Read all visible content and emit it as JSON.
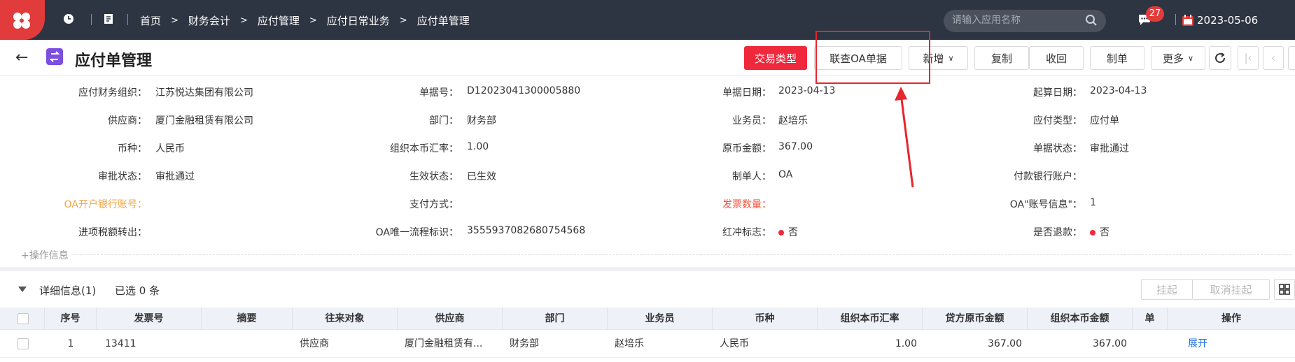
{
  "topbar": {
    "breadcrumbs": [
      "首页",
      "财务会计",
      "应付管理",
      "应付日常业务",
      "应付单管理"
    ],
    "search_placeholder": "请输入应用名称",
    "message_count": "27",
    "date": "2023-05-06"
  },
  "header": {
    "title": "应付单管理",
    "buttons": {
      "trade_type": "交易类型",
      "oa_query": "联查OA单据",
      "add": "新增",
      "copy": "复制",
      "recall": "收回",
      "make": "制单",
      "more": "更多"
    }
  },
  "form": {
    "org_label": "应付财务组织：",
    "org_value": "江苏悦达集团有限公司",
    "billno_label": "单据号：",
    "billno_value": "D12023041300005880",
    "billdate_label": "单据日期：",
    "billdate_value": "2023-04-13",
    "startdate_label": "起算日期：",
    "startdate_value": "2023-04-13",
    "supplier_label": "供应商：",
    "supplier_value": "厦门金融租赁有限公司",
    "dept_label": "部门：",
    "dept_value": "财务部",
    "salesman_label": "业务员：",
    "salesman_value": "赵培乐",
    "paytype_label": "应付类型：",
    "paytype_value": "应付单",
    "currency_label": "币种：",
    "currency_value": "人民币",
    "rate_label": "组织本币汇率：",
    "rate_value": "1.00",
    "amount_label": "原币金额：",
    "amount_value": "367.00",
    "billstatus_label": "单据状态：",
    "billstatus_value": "审批通过",
    "approve_label": "审批状态：",
    "approve_value": "审批通过",
    "effect_label": "生效状态：",
    "effect_value": "已生效",
    "maker_label": "制单人：",
    "maker_value": "OA",
    "bankacct_label": "付款银行账户：",
    "bankacct_value": "",
    "oabank_label": "OA开户银行账号：",
    "oabank_value": "",
    "paymethod_label": "支付方式：",
    "paymethod_value": "",
    "invoicecount_label": "发票数量：",
    "invoicecount_value": "",
    "oaacctinfo_label": "OA\"账号信息\"：",
    "oaacctinfo_value": "1",
    "taxtransfer_label": "进项税额转出：",
    "taxtransfer_value": "",
    "oaflow_label": "OA唯一流程标识：",
    "oaflow_value": "3555937082680754568",
    "redflag_label": "红冲标志：",
    "redflag_value": "否",
    "refund_label": "是否退款：",
    "refund_value": "否",
    "opinfo": "+操作信息"
  },
  "detail": {
    "title": "详细信息(1)",
    "selected": "已选 0 条",
    "hang": "挂起",
    "unhang": "取消挂起",
    "columns": [
      "序号",
      "发票号",
      "摘要",
      "往来对象",
      "供应商",
      "部门",
      "业务员",
      "币种",
      "组织本币汇率",
      "贷方原币金额",
      "组织本币金额",
      "单",
      "操作"
    ],
    "rows": [
      {
        "seq": "1",
        "invoice": "13411",
        "summary": "",
        "target": "供应商",
        "supplier": "厦门金融租赁有...",
        "dept": "财务部",
        "salesman": "赵培乐",
        "currency": "人民币",
        "rate": "1.00",
        "credit": "367.00",
        "local": "367.00",
        "op": "展开"
      }
    ]
  }
}
